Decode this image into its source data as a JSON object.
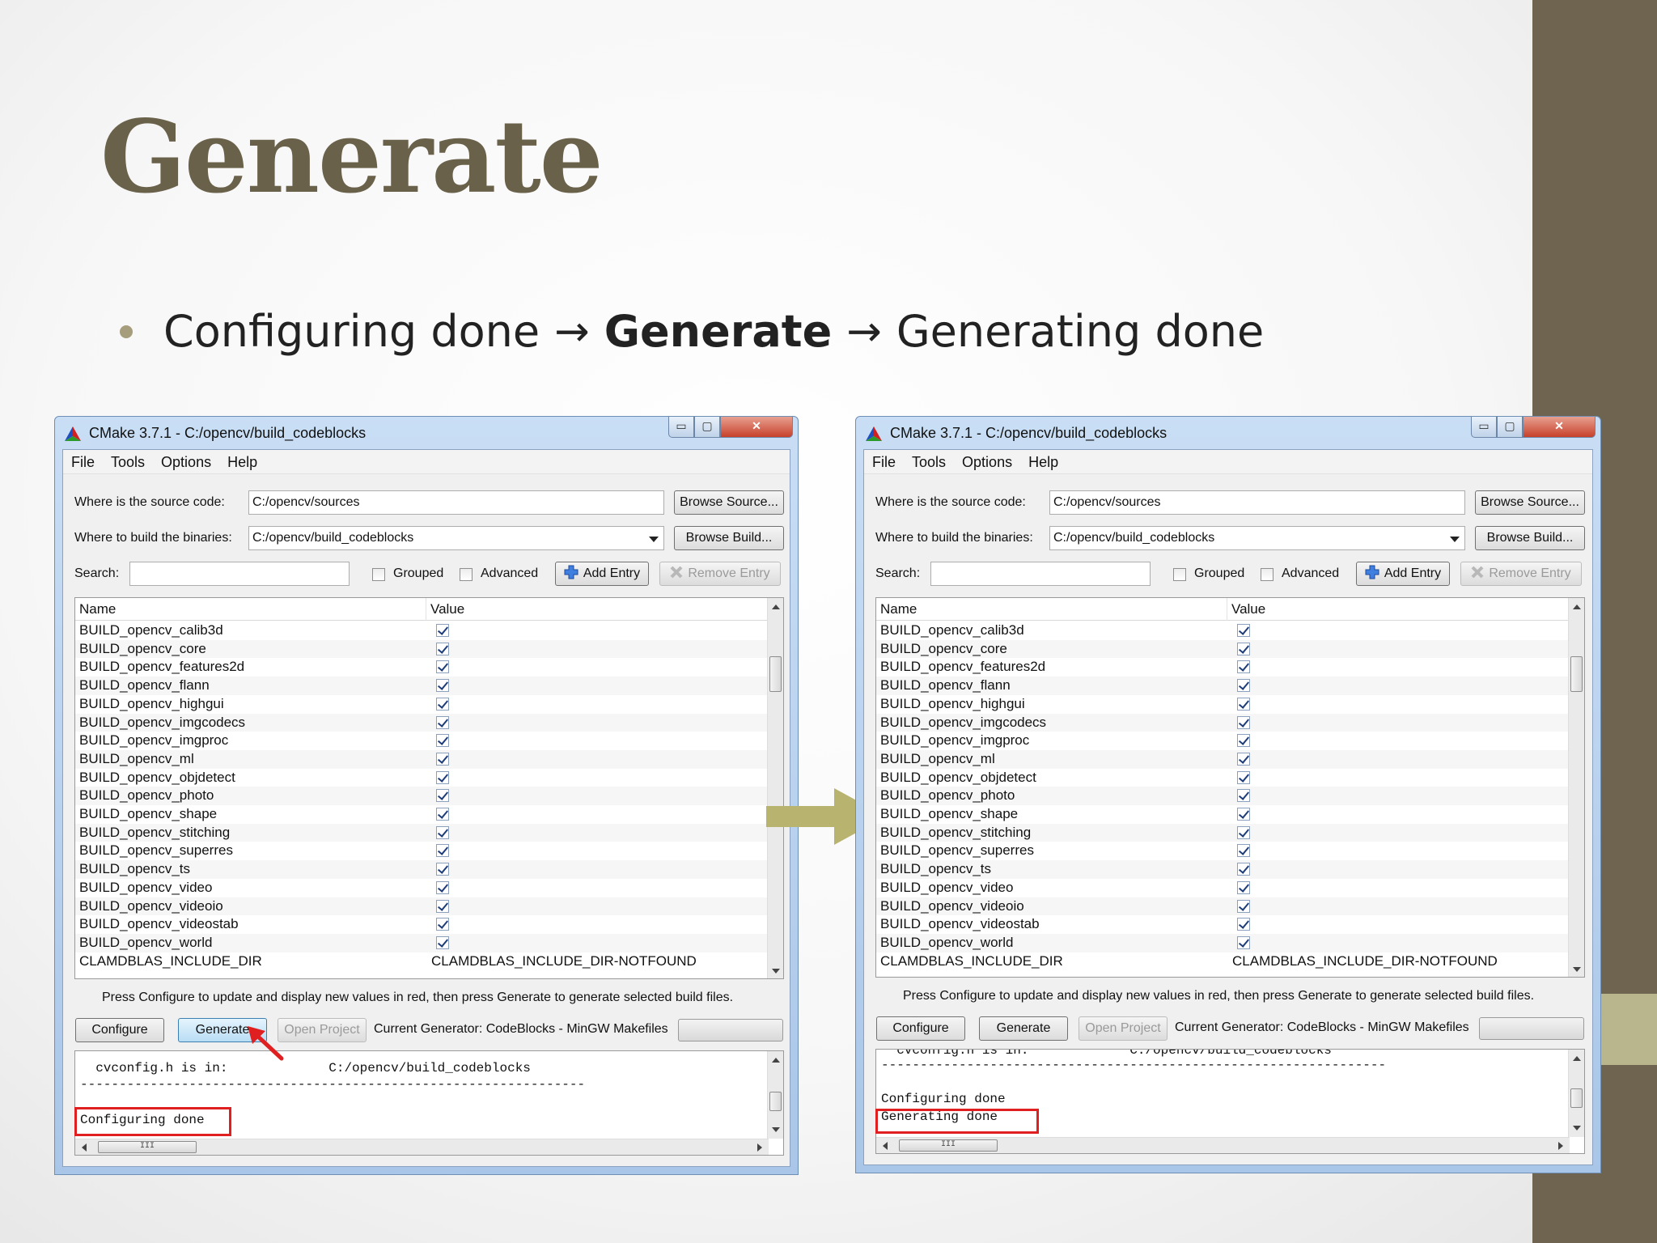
{
  "slide": {
    "title": "Generate",
    "bullet": {
      "part1": "Configuring done",
      "arrow": "→",
      "part2": "Generate",
      "part3": "Generating done"
    },
    "colors": {
      "title": "#6a614a",
      "sidebar": "#6e6450",
      "accent": "#b9b58d",
      "big_arrow": "#b9b370",
      "highlight": "#e02020"
    }
  },
  "window": {
    "title": "CMake 3.7.1 - C:/opencv/build_codeblocks",
    "controls": {
      "minimize": "▭",
      "maximize": "▢",
      "close": "✕"
    },
    "menu": [
      "File",
      "Tools",
      "Options",
      "Help"
    ],
    "source_label": "Where is the source code:",
    "source_value": "C:/opencv/sources",
    "browse_source": "Browse Source...",
    "build_label": "Where to build the binaries:",
    "build_value": "C:/opencv/build_codeblocks",
    "browse_build": "Browse Build...",
    "search_label": "Search:",
    "grouped_label": "Grouped",
    "advanced_label": "Advanced",
    "add_entry": "Add Entry",
    "remove_entry": "Remove Entry",
    "columns": [
      "Name",
      "Value"
    ],
    "rows": [
      {
        "name": "BUILD_opencv_calib3d",
        "checked": true
      },
      {
        "name": "BUILD_opencv_core",
        "checked": true
      },
      {
        "name": "BUILD_opencv_features2d",
        "checked": true
      },
      {
        "name": "BUILD_opencv_flann",
        "checked": true
      },
      {
        "name": "BUILD_opencv_highgui",
        "checked": true
      },
      {
        "name": "BUILD_opencv_imgcodecs",
        "checked": true
      },
      {
        "name": "BUILD_opencv_imgproc",
        "checked": true
      },
      {
        "name": "BUILD_opencv_ml",
        "checked": true
      },
      {
        "name": "BUILD_opencv_objdetect",
        "checked": true
      },
      {
        "name": "BUILD_opencv_photo",
        "checked": true
      },
      {
        "name": "BUILD_opencv_shape",
        "checked": true
      },
      {
        "name": "BUILD_opencv_stitching",
        "checked": true
      },
      {
        "name": "BUILD_opencv_superres",
        "checked": true
      },
      {
        "name": "BUILD_opencv_ts",
        "checked": true
      },
      {
        "name": "BUILD_opencv_video",
        "checked": true
      },
      {
        "name": "BUILD_opencv_videoio",
        "checked": true
      },
      {
        "name": "BUILD_opencv_videostab",
        "checked": true
      },
      {
        "name": "BUILD_opencv_world",
        "checked": true
      },
      {
        "name": "CLAMDBLAS_INCLUDE_DIR",
        "value": "CLAMDBLAS_INCLUDE_DIR-NOTFOUND"
      }
    ],
    "hint": "Press Configure to update and display new values in red, then press Generate to generate selected build files.",
    "configure": "Configure",
    "generate": "Generate",
    "open_project": "Open Project",
    "current_generator": "Current Generator: CodeBlocks - MinGW Makefiles",
    "hscroll_grip": "III"
  },
  "log_left": {
    "line1": "  cvconfig.h is in:             C:/opencv/build_codeblocks",
    "line2": "-----------------------------------------------------------------",
    "line3": "Configuring done"
  },
  "log_right": {
    "line1": "  cvconfig.h is in:             C:/opencv/build_codeblocks",
    "line2": "-----------------------------------------------------------------",
    "line3": "Configuring done",
    "line4": "Generating done"
  }
}
